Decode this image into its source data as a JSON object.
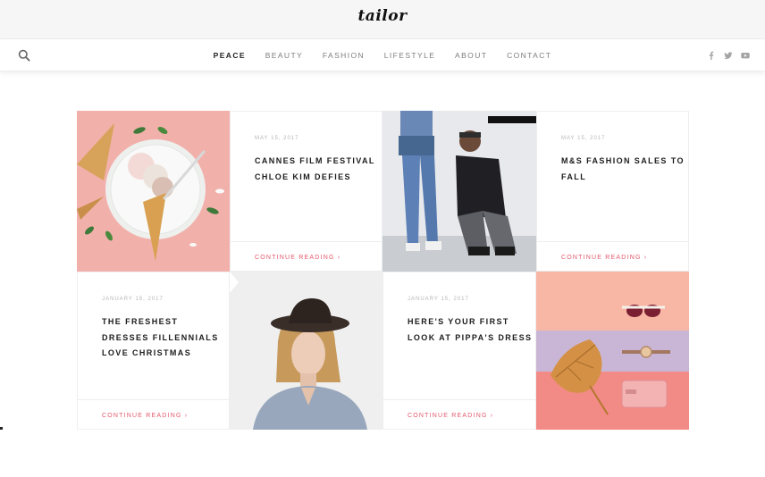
{
  "brand": {
    "logo": "tailor"
  },
  "nav": {
    "items": [
      "PEACE",
      "BEAUTY",
      "FASHION",
      "LIFESTYLE",
      "ABOUT",
      "CONTACT"
    ],
    "active_index": 0
  },
  "icons": {
    "search": "search-icon",
    "social": [
      "facebook-icon",
      "twitter-icon",
      "youtube-icon"
    ]
  },
  "colors": {
    "accent": "#e2596b",
    "pink_tile": "#f2b0ab",
    "nav_active": "#222222"
  },
  "posts": [
    {
      "date": "MAY 15, 2017",
      "title": "CANNES FILM FESTIVAL CHLOE KIM DEFIES",
      "more": "CONTINUE READING"
    },
    {
      "date": "MAY 15, 2017",
      "title": "M&S FASHION SALES TO FALL",
      "more": "CONTINUE READING"
    },
    {
      "date": "JANUARY 15, 2017",
      "title": "THE FRESHEST DRESSES FILLENNIALS LOVE CHRISTMAS",
      "more": "CONTINUE READING"
    },
    {
      "date": "JANUARY 15, 2017",
      "title": "HERE'S YOUR FIRST LOOK AT PIPPA'S DRESS",
      "more": "CONTINUE READING"
    }
  ],
  "images": [
    "ice-cream-cones-plate-photo",
    "couple-jeans-sitting-photo",
    "woman-black-hat-photo",
    "sunglasses-watch-leaf-flatlay-photo"
  ]
}
